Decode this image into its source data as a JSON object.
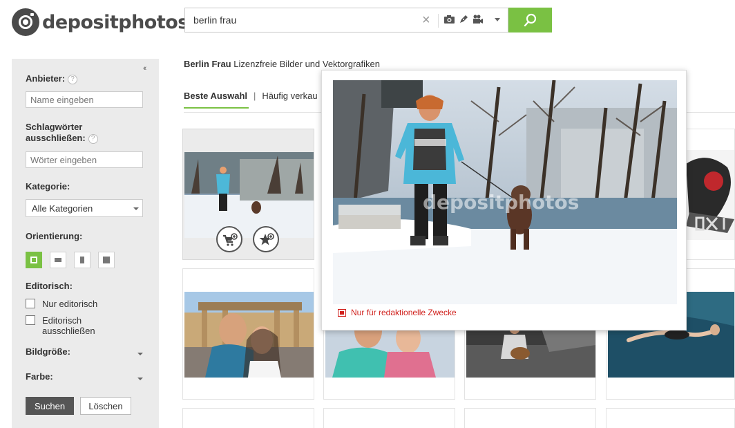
{
  "header": {
    "logo_text": "depositphotos",
    "search_value": "berlin frau",
    "clear_label": "×"
  },
  "sidebar": {
    "collapse_label": "‹‹",
    "provider_label": "Anbieter:",
    "provider_placeholder": "Name eingeben",
    "exclude_label": "Schlagwörter ausschließen:",
    "exclude_placeholder": "Wörter eingeben",
    "category_label": "Kategorie:",
    "category_value": "Alle Kategorien",
    "orientation_label": "Orientierung:",
    "editorial_label": "Editorisch:",
    "editorial_only": "Nur editorisch",
    "editorial_exclude": "Editorisch ausschließen",
    "image_size_label": "Bildgröße:",
    "color_label": "Farbe:",
    "help_label": "?",
    "search_button": "Suchen",
    "clear_button": "Löschen"
  },
  "main": {
    "title_bold": "Berlin Frau",
    "title_rest": " Lizenzfreie Bilder und Vektorgrafiken",
    "tab_best": "Beste Auswahl",
    "tab_sep": "|",
    "tab_frequent": "Häufig verkau"
  },
  "preview": {
    "watermark": "depositphotos",
    "editorial_note": "Nur für redaktionelle Zwecke"
  },
  "colors": {
    "accent": "#7ac143",
    "editorial_red": "#d0201c",
    "sidebar_bg": "#ebebeb",
    "dark_button": "#555555"
  },
  "icons": [
    "camera-icon",
    "pen-icon",
    "video-icon",
    "search-icon",
    "add-to-cart-icon",
    "add-to-favorites-icon",
    "help-icon"
  ]
}
